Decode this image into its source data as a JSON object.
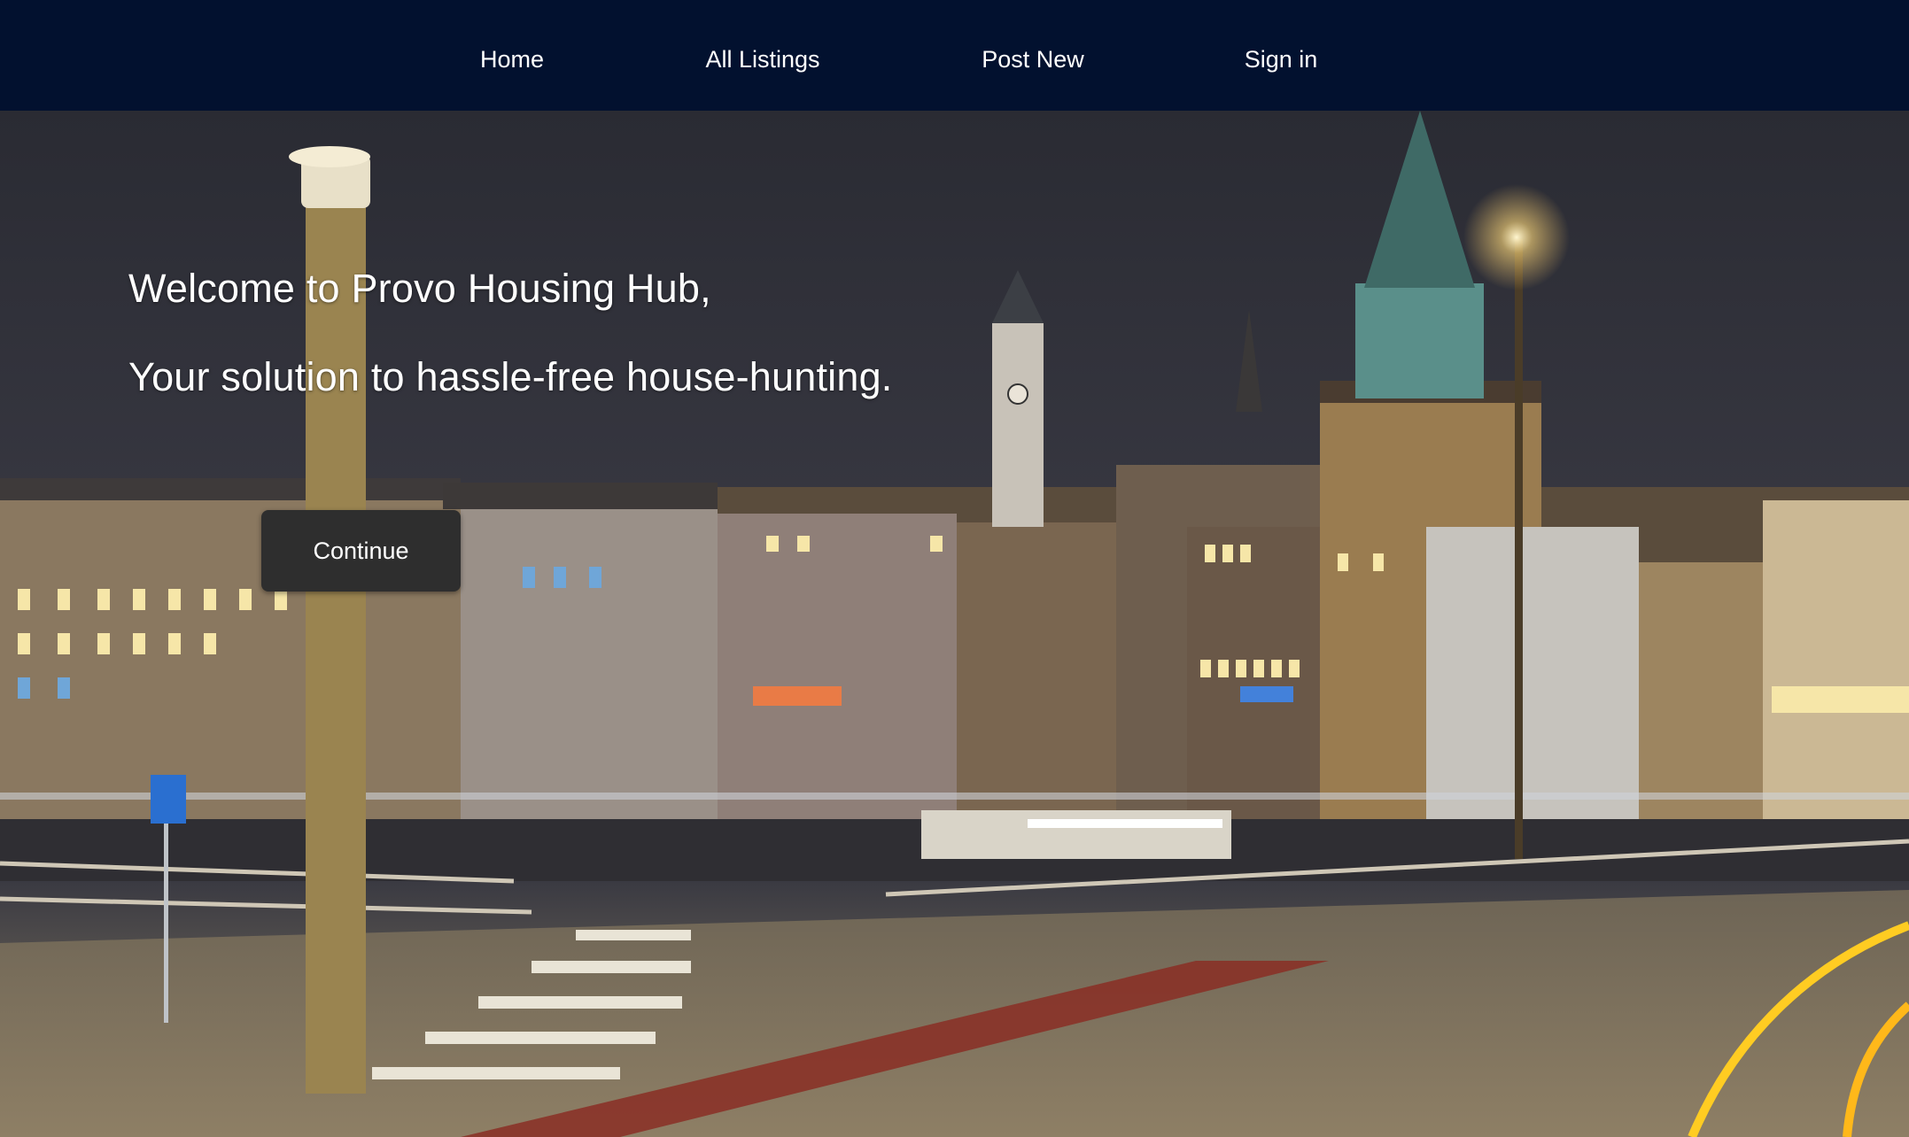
{
  "nav": {
    "home": "Home",
    "all_listings": "All Listings",
    "post_new": "Post New",
    "sign_in": "Sign in"
  },
  "hero": {
    "welcome": "Welcome to Provo Housing Hub,",
    "tagline": "Your solution to hassle-free house-hunting.",
    "continue_label": "Continue",
    "background_image": "night-city-waterfront-photo"
  },
  "colors": {
    "navbar_bg": "#02112f",
    "nav_text": "#ffffff",
    "button_bg": "#2e2e2e",
    "button_text": "#ffffff"
  }
}
